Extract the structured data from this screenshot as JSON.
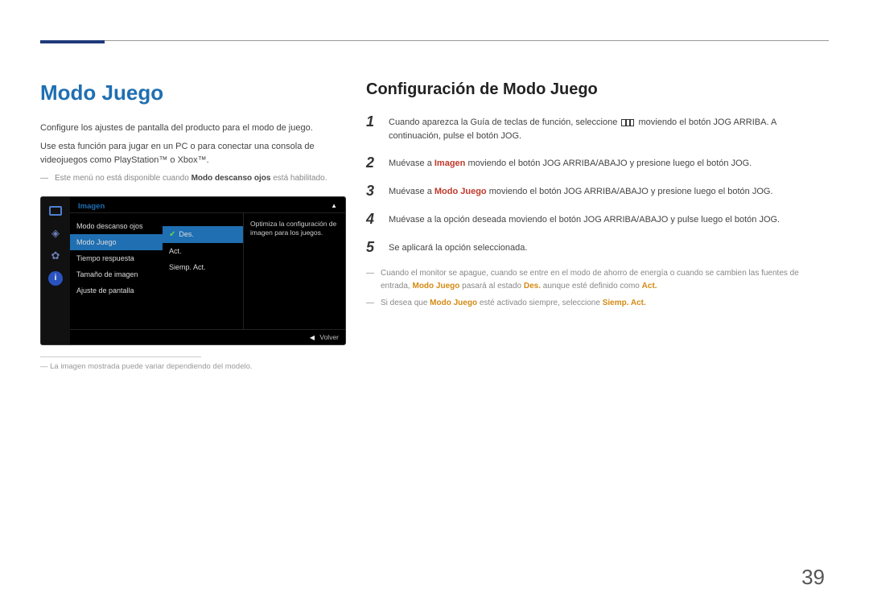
{
  "left": {
    "title": "Modo Juego",
    "p1": "Configure los ajustes de pantalla del producto para el modo de juego.",
    "p2": "Use esta función para jugar en un PC o para conectar una consola de videojuegos como PlayStation™ o Xbox™.",
    "note1_pre": "Este menú no está disponible cuando ",
    "note1_bold": "Modo descanso ojos",
    "note1_post": " está habilitado.",
    "hr_caption_pre": "― ",
    "hr_caption": "La imagen mostrada puede variar dependiendo del modelo."
  },
  "osd": {
    "header": "Imagen",
    "items": [
      "Modo descanso ojos",
      "Modo Juego",
      "Tiempo respuesta",
      "Tamaño de imagen",
      "Ajuste de pantalla"
    ],
    "sub": [
      "Des.",
      "Act.",
      "Siemp. Act."
    ],
    "desc": "Optimiza la configuración de imagen para los juegos.",
    "footer": "Volver"
  },
  "right": {
    "title": "Configuración de Modo Juego",
    "steps": {
      "s1a": "Cuando aparezca la Guía de teclas de función, seleccione ",
      "s1b": " moviendo el botón JOG ARRIBA. A continuación, pulse el botón JOG.",
      "s2a": "Muévase a ",
      "s2b": "Imagen",
      "s2c": " moviendo el botón JOG ARRIBA/ABAJO y presione luego el botón JOG.",
      "s3a": "Muévase a ",
      "s3b": "Modo Juego",
      "s3c": " moviendo el botón JOG ARRIBA/ABAJO y presione luego el botón JOG.",
      "s4": "Muévase a la opción deseada moviendo el botón JOG ARRIBA/ABAJO y pulse luego el botón JOG.",
      "s5": "Se aplicará la opción seleccionada."
    },
    "note2a": "Cuando el monitor se apague, cuando se entre en el modo de ahorro de energía o cuando se cambien las fuentes de entrada, ",
    "note2b": "Modo Juego",
    "note2c": " pasará al estado ",
    "note2d": "Des.",
    "note2e": " aunque esté definido como ",
    "note2f": "Act.",
    "note3a": "Si desea que ",
    "note3b": "Modo Juego",
    "note3c": " esté activado siempre, seleccione ",
    "note3d": "Siemp. Act."
  },
  "page": "39"
}
